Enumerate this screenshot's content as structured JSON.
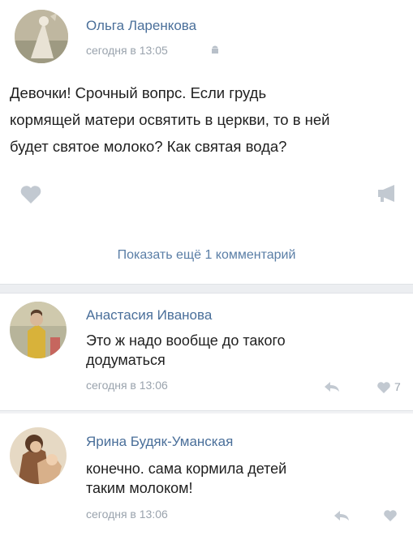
{
  "post": {
    "author": "Ольга Ларенкова",
    "timestamp": "сегодня в 13:05",
    "platform_icon": "android-icon",
    "text_lines": [
      "Девочки! Срочный вопрс. Если грудь",
      "кормящей матери освятить в церкви, то в ней",
      "будет святое молоко? Как святая вода?"
    ],
    "like_icon": "heart-icon",
    "share_icon": "megaphone-icon"
  },
  "show_more": {
    "label": "Показать ещё 1 комментарий"
  },
  "comments": [
    {
      "author": "Анастасия Иванова",
      "text_lines": [
        "Это ж надо вообще до такого",
        "додуматься"
      ],
      "timestamp": "сегодня в 13:06",
      "reply_icon": "reply-icon",
      "like_icon": "heart-icon",
      "likes": "7"
    },
    {
      "author": "Ярина Будяк-Уманская",
      "text_lines": [
        "конечно. сама кормила детей",
        "таким молоком!"
      ],
      "timestamp": "сегодня в 13:06",
      "reply_icon": "reply-icon",
      "like_icon": "heart-icon"
    }
  ],
  "colors": {
    "link": "#4a6f9a",
    "meta": "#9aa3ad",
    "icon": "#b8c0c9",
    "divider": "#eceef1"
  }
}
